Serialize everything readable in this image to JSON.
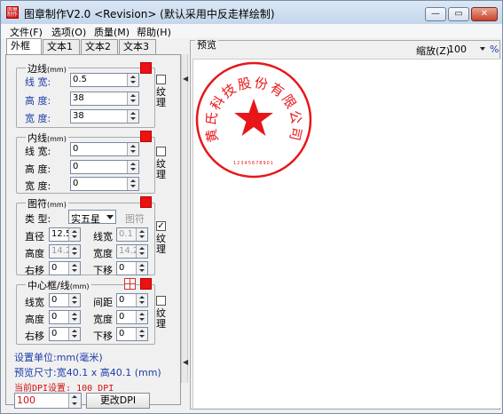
{
  "window": {
    "app_icon_text": "图章制作",
    "title": "图章制作V2.0 <Revision> (默认采用中反走样绘制)",
    "min_symbol": "—",
    "max_symbol": "▭",
    "close_symbol": "✕"
  },
  "menu": [
    "文件(F)",
    "选项(O)",
    "质量(M)",
    "帮助(H)"
  ],
  "tabs": [
    "外框",
    "文本1",
    "文本2",
    "文本3"
  ],
  "frame": {
    "title": "边线",
    "unit": "(mm)",
    "color": "#ee1111",
    "rows": [
      {
        "label": "线 宽:",
        "value": "0.5"
      },
      {
        "label": "高 度:",
        "value": "38"
      },
      {
        "label": "宽 度:",
        "value": "38"
      }
    ],
    "texture_label": "纹理",
    "texture_checked": false
  },
  "inner": {
    "title": "内线",
    "unit": "(mm)",
    "color": "#ee1111",
    "rows": [
      {
        "label": "线 宽:",
        "value": "0"
      },
      {
        "label": "高 度:",
        "value": "0"
      },
      {
        "label": "宽 度:",
        "value": "0"
      }
    ],
    "texture_label": "纹理",
    "texture_checked": false
  },
  "symbol": {
    "title": "图符",
    "unit": "(mm)",
    "color": "#ee1111",
    "type_label": "类 型:",
    "type_value": "实五星",
    "symbol_button": "图符",
    "diameter_label": "直径",
    "diameter_value": "12.5",
    "linewidth_label": "线宽",
    "linewidth_value": "0.1",
    "height_label": "高度",
    "height_value": "14.2",
    "width_label": "宽度",
    "width_value": "14.2",
    "right_label": "右移",
    "right_value": "0",
    "down_label": "下移",
    "down_value": "0",
    "texture_label": "纹理",
    "texture_checked": true,
    "check_mark": "✓"
  },
  "center": {
    "title": "中心框/线",
    "unit": "(mm)",
    "color": "#ee1111",
    "linewidth_label": "线宽",
    "linewidth_value": "0",
    "gap_label": "间距",
    "gap_value": "0",
    "height_label": "高度",
    "height_value": "0",
    "width_label": "宽度",
    "width_value": "0",
    "right_label": "右移",
    "right_value": "0",
    "down_label": "下移",
    "down_value": "0",
    "texture_label": "纹理",
    "texture_checked": false
  },
  "status": {
    "unit": "设置单位:mm(毫米)",
    "preview_size": "预览尺寸:宽40.1 x 高40.1 (mm)",
    "dpi": "当前DPI设置: 100 DPI",
    "dpi_value": "100",
    "change_dpi": "更改DPI"
  },
  "preview": {
    "label": "预览",
    "zoom_label": "缩放(Z)",
    "zoom_value": "100",
    "percent": "%",
    "stamp_color": "#e8161a",
    "stamp_text": "黄氏科技股份有限公司",
    "stamp_code": "12345678901"
  }
}
